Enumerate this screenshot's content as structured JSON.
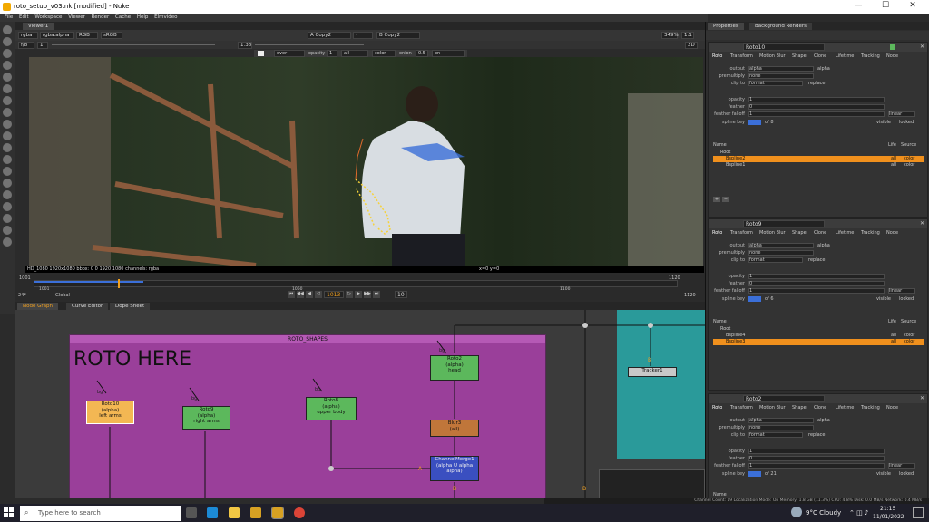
{
  "window": {
    "title": "roto_setup_v03.nk [modified] - Nuke",
    "minimize": "—",
    "maximize": "☐",
    "close": "✕"
  },
  "menu": [
    "File",
    "Edit",
    "Workspace",
    "Viewer",
    "Render",
    "Cache",
    "Help",
    "Elmvideo"
  ],
  "viewer": {
    "tab": "Viewer1",
    "channels": "rgba",
    "layer": "rgba.alpha",
    "display": "RGB",
    "lut": "sRGB",
    "input_a": "A  Copy2",
    "input_b": "B  Copy2",
    "zoom": "349%",
    "ratio": "1:1",
    "proxy": "2D",
    "frame_field": "f/8",
    "gain": "1",
    "gamma": "1.38",
    "overlay": "over",
    "opacity_label": "opacity",
    "opacity": "1",
    "channel_sel": "all",
    "color_mode": "color",
    "onion_label": "onion",
    "onion": "0.5",
    "selection": "on selection",
    "info": "HD_1080 1920x1080  bbox: 0 0 1920 1080  channels: rgba",
    "coords": "x=0 y=0"
  },
  "timeline": {
    "start": "1001",
    "tick_mid": "1060",
    "tick_end": "1100",
    "end_top": "1120",
    "end": "1120",
    "fps": "24*",
    "scope": "Global",
    "current": "1013",
    "inc": "10"
  },
  "nodegraph_tabs": [
    "Node Graph",
    "Curve Editor",
    "Dope Sheet"
  ],
  "nodegraph": {
    "backdrop_title": "ROTO_SHAPES",
    "backdrop_big": "ROTO HERE",
    "nodes": [
      {
        "id": "roto10",
        "lines": [
          "Roto10",
          "(alpha)",
          "left arms"
        ],
        "color": "#f3b753"
      },
      {
        "id": "roto9",
        "lines": [
          "Roto9",
          "(alpha)",
          "right arms"
        ],
        "color": "#5cb85c"
      },
      {
        "id": "roto8",
        "lines": [
          "Roto8",
          "(alpha)",
          "upper body"
        ],
        "color": "#5cb85c"
      },
      {
        "id": "roto2",
        "lines": [
          "Roto2",
          "(alpha)",
          "head"
        ],
        "color": "#5cb85c"
      },
      {
        "id": "blur3",
        "lines": [
          "Blur3",
          "(all)"
        ],
        "color": "#c0763a"
      },
      {
        "id": "merge1",
        "lines": [
          "ChannelMerge1",
          "(alpha U alpha",
          "alpha)"
        ],
        "color": "#3a4fc0"
      },
      {
        "id": "tracker1",
        "lines": [
          "Tracker1"
        ],
        "color": "#c8c8c8"
      }
    ],
    "pipe_label_bg": "bg",
    "pipe_label_a": "A",
    "pipe_label_b": "B"
  },
  "props": {
    "tabs": [
      "Properties",
      "Background Renders"
    ],
    "panels": [
      {
        "name": "Roto10",
        "output": "alpha",
        "premult": "none",
        "clip": "format",
        "opacity": "1",
        "feather": "0",
        "falloff": "1",
        "falloff_type": "linear",
        "spline_of": "of 8",
        "items": [
          "Root",
          "Bspline2",
          "Bspline1"
        ],
        "sel": 1
      },
      {
        "name": "Roto9",
        "output": "alpha",
        "premult": "none",
        "clip": "format",
        "opacity": "1",
        "feather": "0",
        "falloff": "1",
        "falloff_type": "linear",
        "spline_of": "of 6",
        "items": [
          "Root",
          "Bspline4",
          "Bspline3"
        ],
        "sel": 2
      },
      {
        "name": "Roto2",
        "output": "alpha",
        "premult": "none",
        "clip": "format",
        "opacity": "1",
        "feather": "0",
        "falloff": "1",
        "falloff_type": "linear",
        "spline_of": "of 21",
        "items": [],
        "sel": -1
      }
    ],
    "ptabs": [
      "Roto",
      "Transform",
      "Motion Blur",
      "Shape",
      "Clone",
      "Lifetime",
      "Tracking",
      "Node"
    ],
    "labels": {
      "output": "output",
      "premult": "premultiply",
      "clip": "clip to",
      "opacity": "opacity",
      "feather": "feather",
      "falloff": "feather falloff",
      "spline": "spline key",
      "replace": "replace",
      "alpha_chk": "alpha",
      "name_col": "Name",
      "life": "Life",
      "source": "Source",
      "all": "all",
      "color": "color",
      "visible": "visible",
      "locked": "locked",
      "on": "on"
    }
  },
  "status": "Channel Count: 19  Localization Mode: On  Memory: 1.8 GB (11.3%)  CPU: 4.8%  Disk: 0.0 MB/s  Network: 0.4 MB/s",
  "taskbar": {
    "search": "Type here to search",
    "weather": "9°C  Cloudy",
    "time": "21:15",
    "date": "11/01/2022"
  }
}
